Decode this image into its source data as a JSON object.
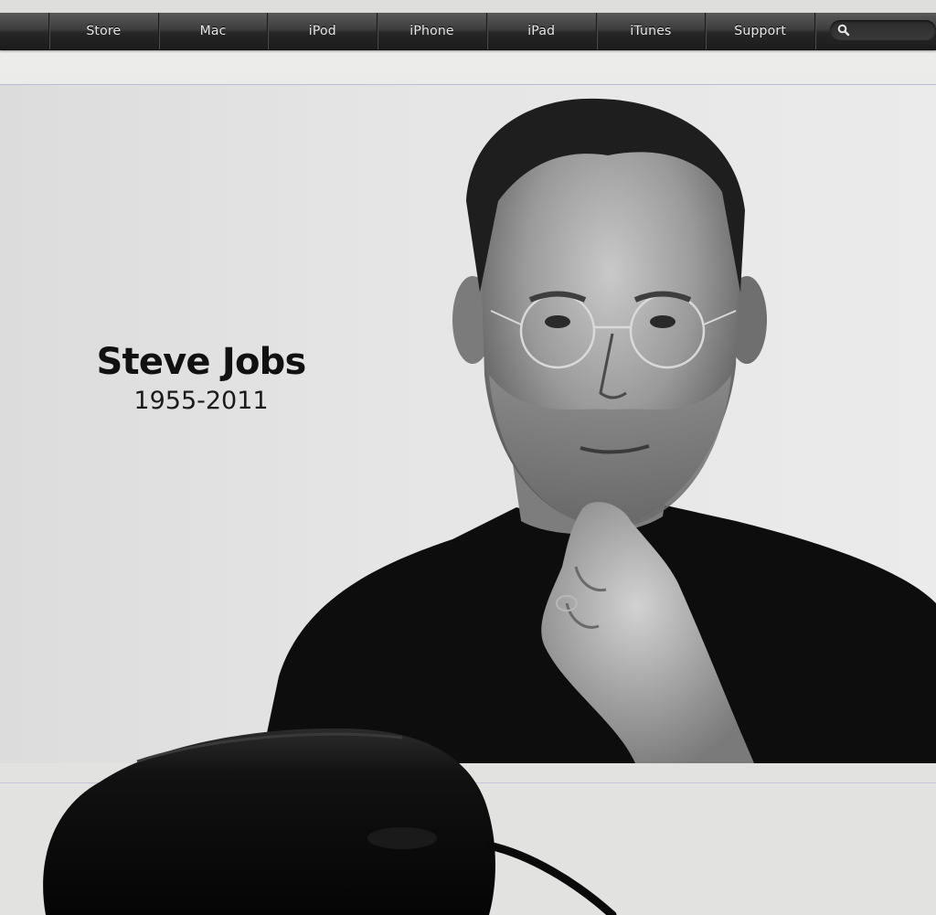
{
  "nav": {
    "items": [
      {
        "label": "Store"
      },
      {
        "label": "Mac"
      },
      {
        "label": "iPod"
      },
      {
        "label": "iPhone"
      },
      {
        "label": "iPad"
      },
      {
        "label": "iTunes"
      },
      {
        "label": "Support"
      }
    ],
    "search_icon": "search-icon"
  },
  "hero": {
    "name": "Steve Jobs",
    "years": "1955-2011"
  },
  "colors": {
    "nav_bg": "#2a2a2a",
    "nav_text": "#e8e8e8",
    "page_bg": "#e6e6e4",
    "hero_text": "#111111"
  }
}
